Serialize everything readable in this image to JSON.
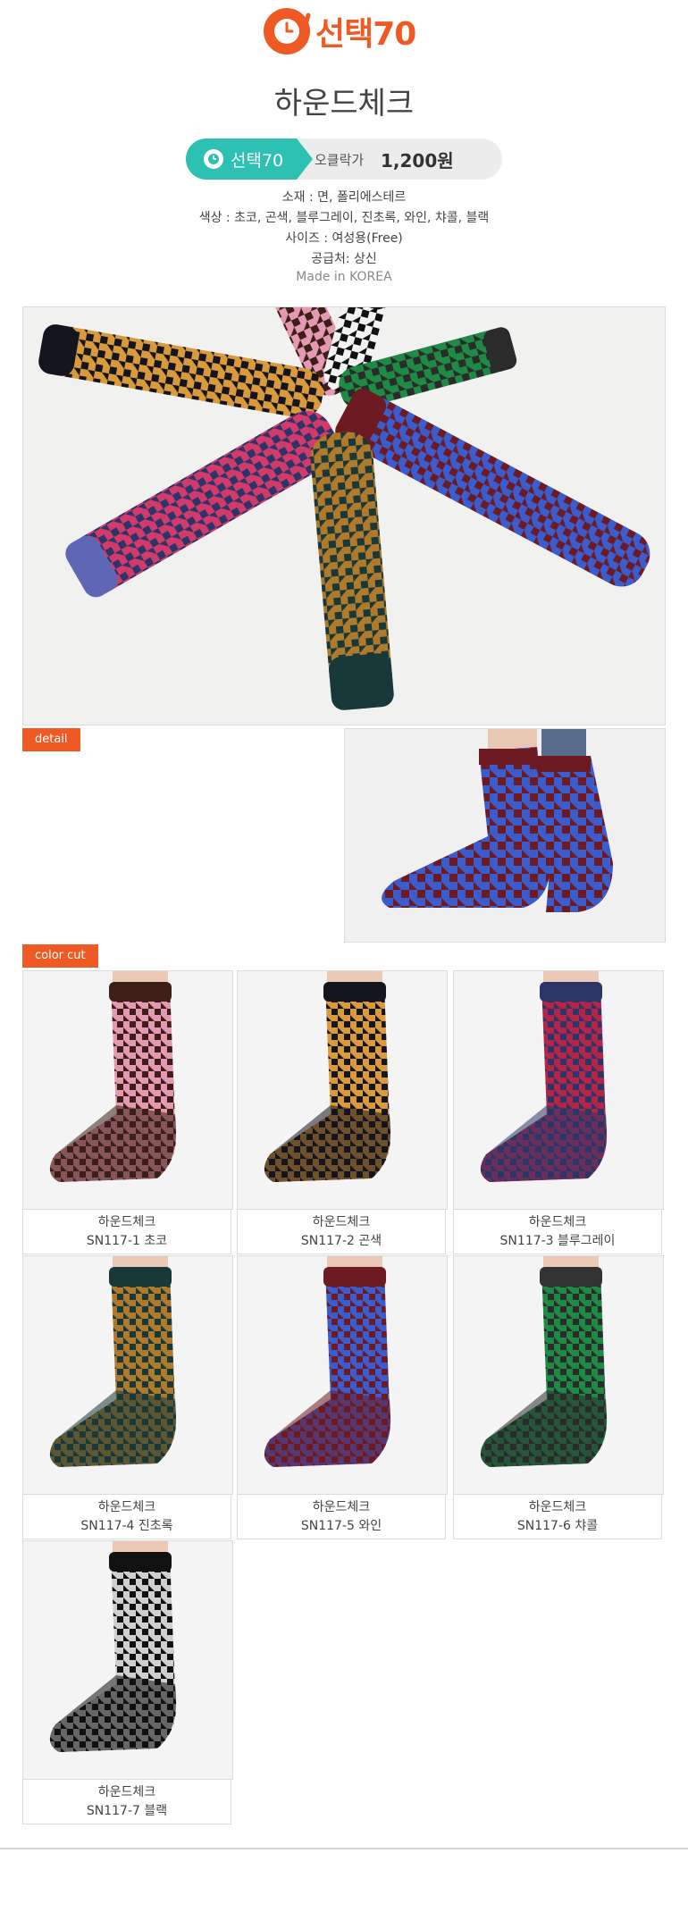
{
  "brand": {
    "name": "선택70",
    "primary": "#ef5a24",
    "accent": "#2cc1b2"
  },
  "product": {
    "title": "하운드체크",
    "pill_brand": "선택70",
    "price_label": "오클락가",
    "price": "1,200원"
  },
  "specs": {
    "material": "소재 :  면, 폴리에스테르",
    "colors": "색상 :  초코, 곤색, 블루그레이, 진초록, 와인, 챠콜, 블랙",
    "size": "사이즈 :  여성용(Free)",
    "supplier": "공급처: 상신",
    "origin": "Made in KOREA"
  },
  "sections": {
    "detail": "detail",
    "color_cut": "color cut"
  },
  "variants": [
    {
      "name": "하운드체크",
      "code": "SN117-1 초코",
      "cuff": "#3d1f18",
      "light": "#e39ab0",
      "dark": "#3d1f18"
    },
    {
      "name": "하운드체크",
      "code": "SN117-2 곤색",
      "cuff": "#15151f",
      "light": "#d99a3c",
      "dark": "#15151f"
    },
    {
      "name": "하운드체크",
      "code": "SN117-3 블루그레이",
      "cuff": "#2b3568",
      "light": "#b3264a",
      "dark": "#2b3568"
    },
    {
      "name": "하운드체크",
      "code": "SN117-4 진초록",
      "cuff": "#19383a",
      "light": "#b07a2c",
      "dark": "#19383a"
    },
    {
      "name": "하운드체크",
      "code": "SN117-5 와인",
      "cuff": "#6e1a22",
      "light": "#3a5ccc",
      "dark": "#6e1a22"
    },
    {
      "name": "하운드체크",
      "code": "SN117-6 챠콜",
      "cuff": "#333333",
      "light": "#1e8a45",
      "dark": "#2b2b2b"
    },
    {
      "name": "하운드체크",
      "code": "SN117-7 블랙",
      "cuff": "#111111",
      "light": "#cfcfcf",
      "dark": "#111111"
    }
  ]
}
